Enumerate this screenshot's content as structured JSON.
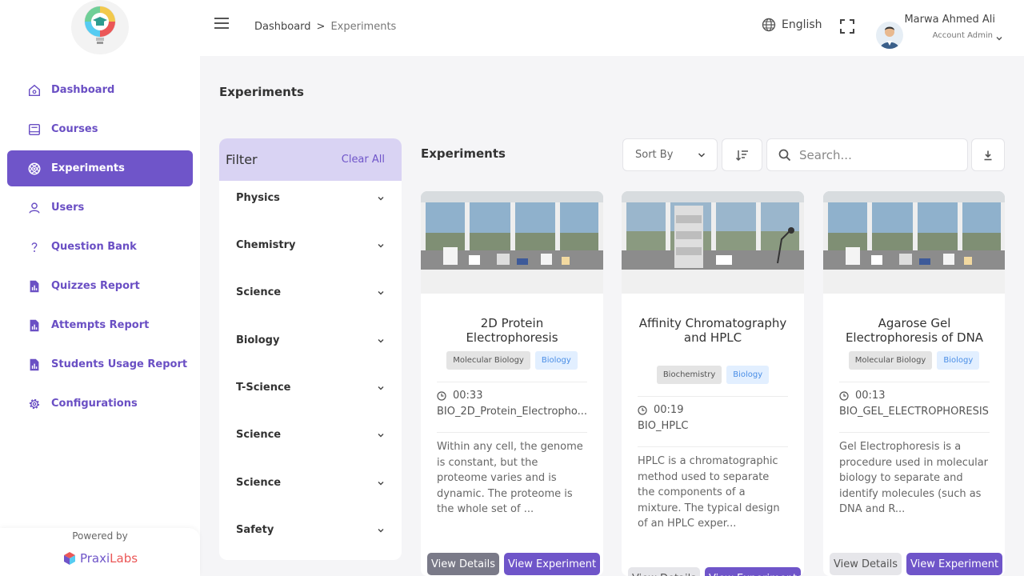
{
  "sidebar": {
    "items": [
      {
        "label": "Dashboard",
        "icon": "home-icon"
      },
      {
        "label": "Courses",
        "icon": "book-icon"
      },
      {
        "label": "Experiments",
        "icon": "atom-icon",
        "active": true
      },
      {
        "label": "Users",
        "icon": "user-icon"
      },
      {
        "label": "Question Bank",
        "icon": "question-icon"
      },
      {
        "label": "Quizzes Report",
        "icon": "report-icon"
      },
      {
        "label": "Attempts Report",
        "icon": "report-icon"
      },
      {
        "label": "Students Usage Report",
        "icon": "report-icon"
      },
      {
        "label": "Configurations",
        "icon": "gear-icon"
      }
    ],
    "powered_by": "Powered by",
    "brand_part1": "Praxi",
    "brand_part2": "Labs"
  },
  "header": {
    "breadcrumb": [
      "Dashboard",
      "Experiments"
    ],
    "language": "English",
    "user_name": "Marwa Ahmed Ali",
    "user_role": "Account Admin"
  },
  "page": {
    "title": "Experiments"
  },
  "filter": {
    "title": "Filter",
    "clear": "Clear All",
    "items": [
      "Physics",
      "Chemistry",
      "Science",
      "Biology",
      "T-Science",
      "Science",
      "Science",
      "Safety"
    ]
  },
  "list": {
    "title": "Experiments",
    "sort_label": "Sort By",
    "search_placeholder": "Search..."
  },
  "cards": [
    {
      "title": "2D Protein Electrophoresis",
      "tag1": "Molecular Biology",
      "tag2": "Biology",
      "duration": "00:33",
      "code": "BIO_2D_Protein_Electropho...",
      "description": "Within any cell, the genome is constant, but the proteome varies and is dynamic. The proteome is the whole set of ...",
      "details_label": "View Details",
      "experiment_label": "View Experiment"
    },
    {
      "title": "Affinity Chromatography and HPLC",
      "tag1": "Biochemistry",
      "tag2": "Biology",
      "duration": "00:19",
      "code": "BIO_HPLC",
      "description": "HPLC is a chromatographic method used to separate the components of a mixture. The typical design of an HPLC exper...",
      "details_label": "View Details",
      "experiment_label": "View Experiment"
    },
    {
      "title": "Agarose Gel Electrophoresis of DNA",
      "tag1": "Molecular Biology",
      "tag2": "Biology",
      "duration": "00:13",
      "code": "BIO_GEL_ELECTROPHORESIS",
      "description": "Gel Electrophoresis is a procedure used in molecular biology to separate and identify molecules (such as DNA and R...",
      "details_label": "View Details",
      "experiment_label": "View Experiment"
    }
  ],
  "colors": {
    "accent": "#6f55c9",
    "filter_header": "#d9d3f3",
    "tag_blue": "#4a8ee6"
  }
}
